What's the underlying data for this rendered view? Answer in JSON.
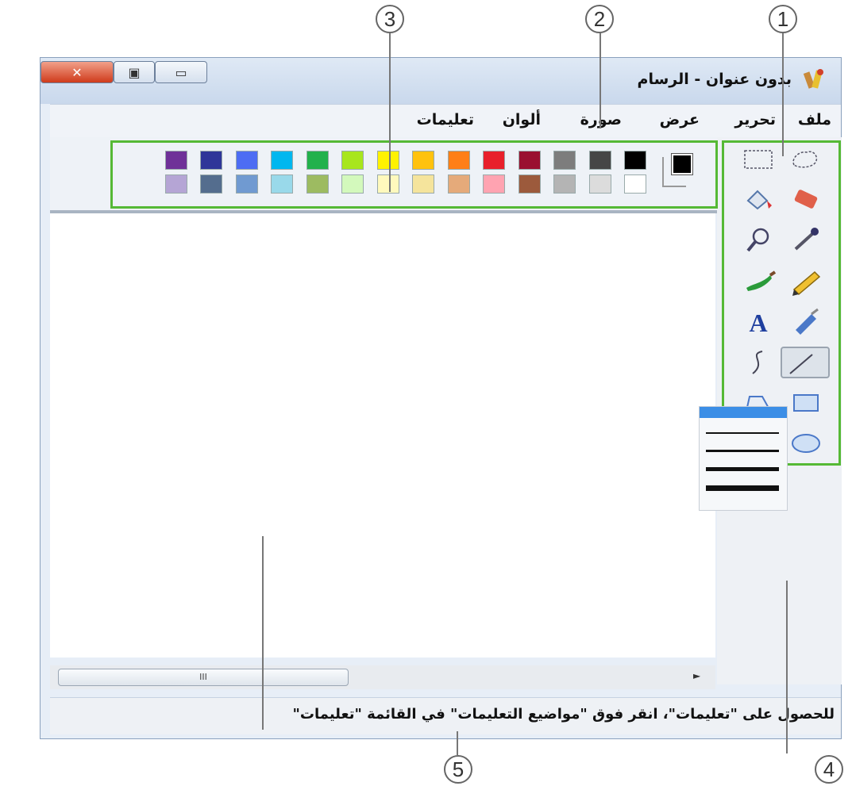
{
  "callouts": [
    "1",
    "2",
    "3",
    "4",
    "5"
  ],
  "window": {
    "title": "بدون عنوان - الرسام",
    "close_glyph": "✕",
    "restore_glyph": "▣",
    "min_glyph": "▭"
  },
  "menu": [
    "ملف",
    "تحرير",
    "عرض",
    "صورة",
    "ألوان",
    "تعليمات"
  ],
  "palette": {
    "current_color": "#000000",
    "top_row": [
      "#000000",
      "#464646",
      "#7d7d7d",
      "#9a1030",
      "#e8202b",
      "#ff7f17",
      "#ffc20e",
      "#fff200",
      "#a8e61d",
      "#22b14c",
      "#00b7ef",
      "#4d6df3",
      "#2f3699",
      "#6f3198"
    ],
    "bottom_row": [
      "#ffffff",
      "#dcdcdc",
      "#b4b4b4",
      "#9c5a3c",
      "#ffa3b1",
      "#e5aa7a",
      "#f5e49c",
      "#fff9bd",
      "#d3f9bc",
      "#9dbb61",
      "#99d9ea",
      "#709ad1",
      "#546d8e",
      "#b5a5d5"
    ]
  },
  "tools": [
    {
      "icon": "free-form-select-icon"
    },
    {
      "icon": "rect-select-icon"
    },
    {
      "icon": "eraser-icon"
    },
    {
      "icon": "fill-bucket-icon"
    },
    {
      "icon": "color-picker-icon"
    },
    {
      "icon": "magnifier-icon"
    },
    {
      "icon": "pencil-icon"
    },
    {
      "icon": "brush-icon"
    },
    {
      "icon": "airbrush-icon"
    },
    {
      "icon": "text-icon",
      "label": "A"
    },
    {
      "icon": "line-icon",
      "selected": true
    },
    {
      "icon": "curve-icon"
    },
    {
      "icon": "rectangle-icon"
    },
    {
      "icon": "polygon-icon"
    },
    {
      "icon": "ellipse-icon"
    },
    {
      "icon": "rounded-rect-icon"
    }
  ],
  "scroll": {
    "thumb_label": "III",
    "arrow": "►"
  },
  "status": {
    "text": "للحصول على \"تعليمات\"، انقر فوق \"مواضيع التعليمات\" في القائمة \"تعليمات\""
  },
  "colors": {
    "highlight": "#55b935"
  }
}
